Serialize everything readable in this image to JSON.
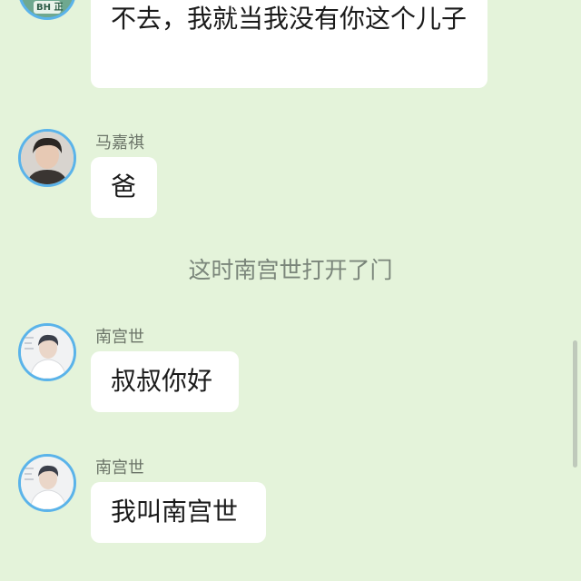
{
  "messages": [
    {
      "sender": "",
      "text": "不去，我就当我没有你这个儿子",
      "avatar_icon": "green-logo-avatar-icon",
      "avatar_text": "BH 正"
    },
    {
      "sender": "马嘉祺",
      "text": "爸",
      "avatar_icon": "user-photo-avatar-icon"
    },
    {
      "sender": "南宫世",
      "text": "叔叔你好",
      "avatar_icon": "user-photo-avatar-icon"
    },
    {
      "sender": "南宫世",
      "text": "我叫南宫世",
      "avatar_icon": "user-photo-avatar-icon"
    }
  ],
  "narration": "这时南宫世打开了门",
  "colors": {
    "background": "#e4f3da",
    "bubble": "#ffffff",
    "avatar_border": "#5ab3ea",
    "logo_avatar_bg": "#6fa88f"
  }
}
